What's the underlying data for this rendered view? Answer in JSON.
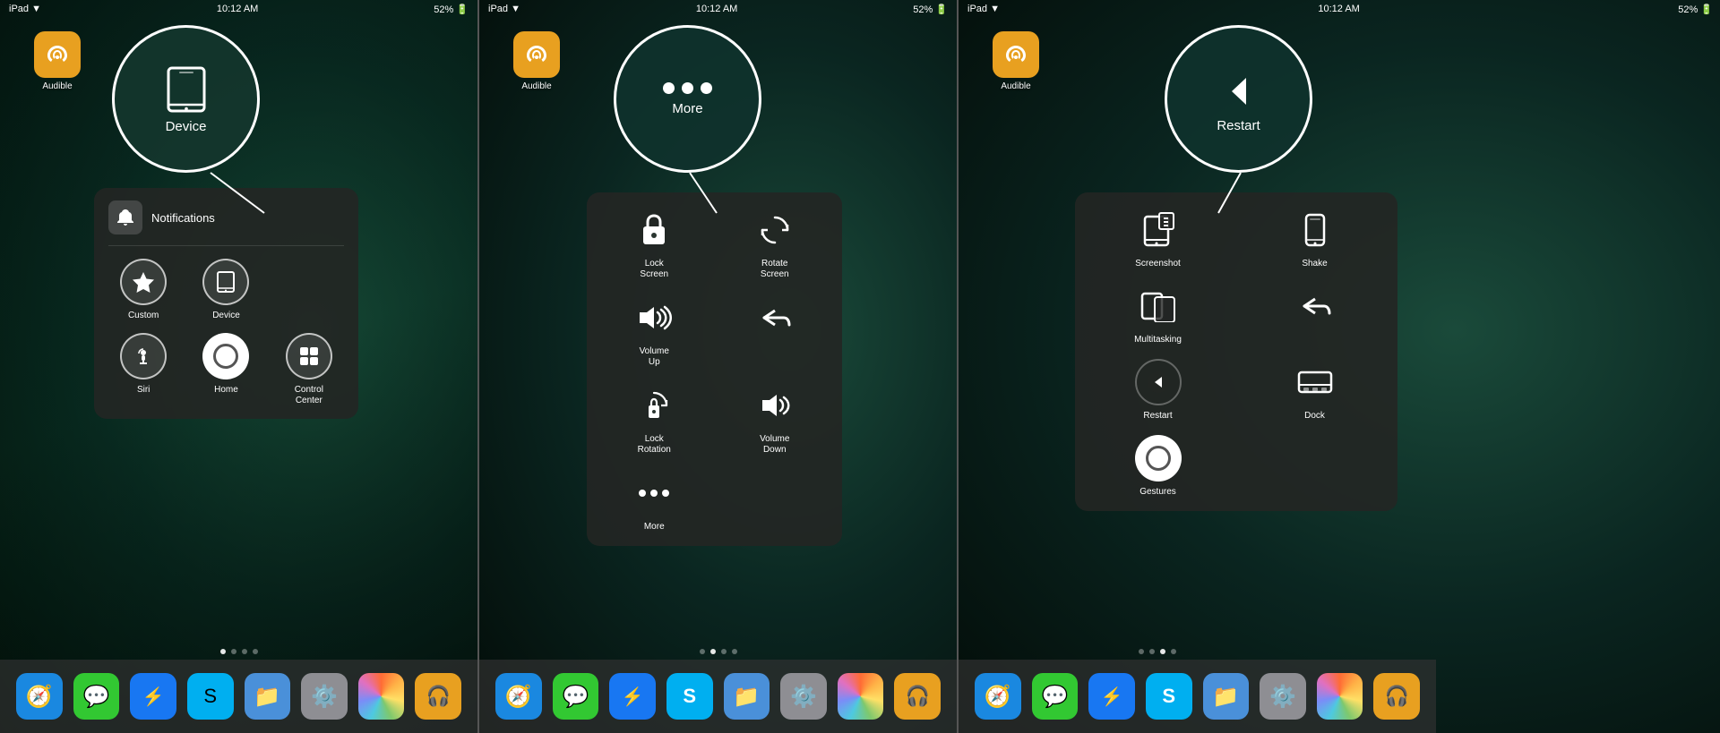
{
  "panels": [
    {
      "id": "panel1",
      "statusBar": {
        "left": "iPad ▼",
        "center": "10:12 AM",
        "right": "52% 🔋"
      },
      "highlightCircle": {
        "label": "Device",
        "iconType": "tablet"
      },
      "audibleApp": {
        "label": "Audible"
      },
      "menu": {
        "topItem": {
          "label": "Notifications",
          "iconType": "bell"
        },
        "items": [
          {
            "label": "Custom",
            "iconType": "star"
          },
          {
            "label": "Device",
            "iconType": "tablet-small"
          },
          {
            "label": "Siri",
            "iconType": "mic"
          },
          {
            "label": "Home",
            "iconType": "circle-filled"
          },
          {
            "label": "Control\nCenter",
            "iconType": "toggle"
          }
        ]
      },
      "dock": {
        "apps": [
          {
            "label": "Safari",
            "color": "#1a88e0",
            "icon": "🧭"
          },
          {
            "label": "Messages",
            "color": "#32c832",
            "icon": "💬"
          },
          {
            "label": "Messenger",
            "color": "#1877f2",
            "icon": "💬"
          },
          {
            "label": "Skype",
            "color": "#00aff0",
            "icon": "📞"
          },
          {
            "label": "Files",
            "color": "#4a90d9",
            "icon": "📁"
          },
          {
            "label": "Settings",
            "color": "#8e8e93",
            "icon": "⚙️"
          },
          {
            "label": "Photos",
            "color": "#ff6b35",
            "icon": "🌸"
          },
          {
            "label": "Audible",
            "color": "#e8a020",
            "icon": "🎧"
          }
        ]
      },
      "pageDots": [
        true,
        false,
        false,
        false
      ]
    },
    {
      "id": "panel2",
      "statusBar": {
        "left": "iPad ▼",
        "center": "10:12 AM",
        "right": "52% 🔋"
      },
      "highlightCircle": {
        "label": "More",
        "iconType": "dots"
      },
      "audibleApp": {
        "label": "Audible"
      },
      "menu": {
        "items": [
          {
            "label": "Lock\nScreen",
            "iconType": "lock"
          },
          {
            "label": "Rotate\nScreen",
            "iconType": "rotate"
          },
          {
            "label": "Volume\nUp",
            "iconType": "volume-up"
          },
          {
            "label": "",
            "iconType": "undo"
          },
          {
            "label": "Lock\nRotation",
            "iconType": "lock-rotate"
          },
          {
            "label": "Volume\nDown",
            "iconType": "volume-down"
          },
          {
            "label": "More",
            "iconType": "dots-small"
          }
        ]
      },
      "dock": {
        "apps": [
          {
            "label": "Safari",
            "color": "#1a88e0",
            "icon": "🧭"
          },
          {
            "label": "Messages",
            "color": "#32c832",
            "icon": "💬"
          },
          {
            "label": "Messenger",
            "color": "#1877f2",
            "icon": "💬"
          },
          {
            "label": "Skype",
            "color": "#00aff0",
            "icon": "📞"
          },
          {
            "label": "Files",
            "color": "#4a90d9",
            "icon": "📁"
          },
          {
            "label": "Settings",
            "color": "#8e8e93",
            "icon": "⚙️"
          },
          {
            "label": "Photos",
            "color": "#ff6b35",
            "icon": "🌸"
          },
          {
            "label": "Audible",
            "color": "#e8a020",
            "icon": "🎧"
          }
        ]
      },
      "pageDots": [
        false,
        true,
        false,
        false
      ]
    },
    {
      "id": "panel3",
      "statusBar": {
        "left": "iPad ▼",
        "center": "10:12 AM",
        "right": "52% 🔋"
      },
      "highlightCircle": {
        "label": "Restart",
        "iconType": "back"
      },
      "audibleApp": {
        "label": "Audible"
      },
      "menu": {
        "items": [
          {
            "label": "Screenshot",
            "iconType": "screenshot"
          },
          {
            "label": "Shake",
            "iconType": "shake"
          },
          {
            "label": "Multitasking",
            "iconType": "multitask"
          },
          {
            "label": "",
            "iconType": "undo"
          },
          {
            "label": "Restart",
            "iconType": "restart"
          },
          {
            "label": "Dock",
            "iconType": "dock"
          },
          {
            "label": "Gestures",
            "iconType": "gestures"
          }
        ]
      },
      "dock": {
        "apps": [
          {
            "label": "Safari",
            "color": "#1a88e0",
            "icon": "🧭"
          },
          {
            "label": "Messages",
            "color": "#32c832",
            "icon": "💬"
          },
          {
            "label": "Messenger",
            "color": "#1877f2",
            "icon": "💬"
          },
          {
            "label": "Skype",
            "color": "#00aff0",
            "icon": "📞"
          },
          {
            "label": "Files",
            "color": "#4a90d9",
            "icon": "📁"
          },
          {
            "label": "Settings",
            "color": "#8e8e93",
            "icon": "⚙️"
          },
          {
            "label": "Photos",
            "color": "#ff6b35",
            "icon": "🌸"
          },
          {
            "label": "Audible",
            "color": "#e8a020",
            "icon": "🎧"
          }
        ]
      },
      "pageDots": [
        false,
        false,
        true,
        false
      ]
    }
  ]
}
